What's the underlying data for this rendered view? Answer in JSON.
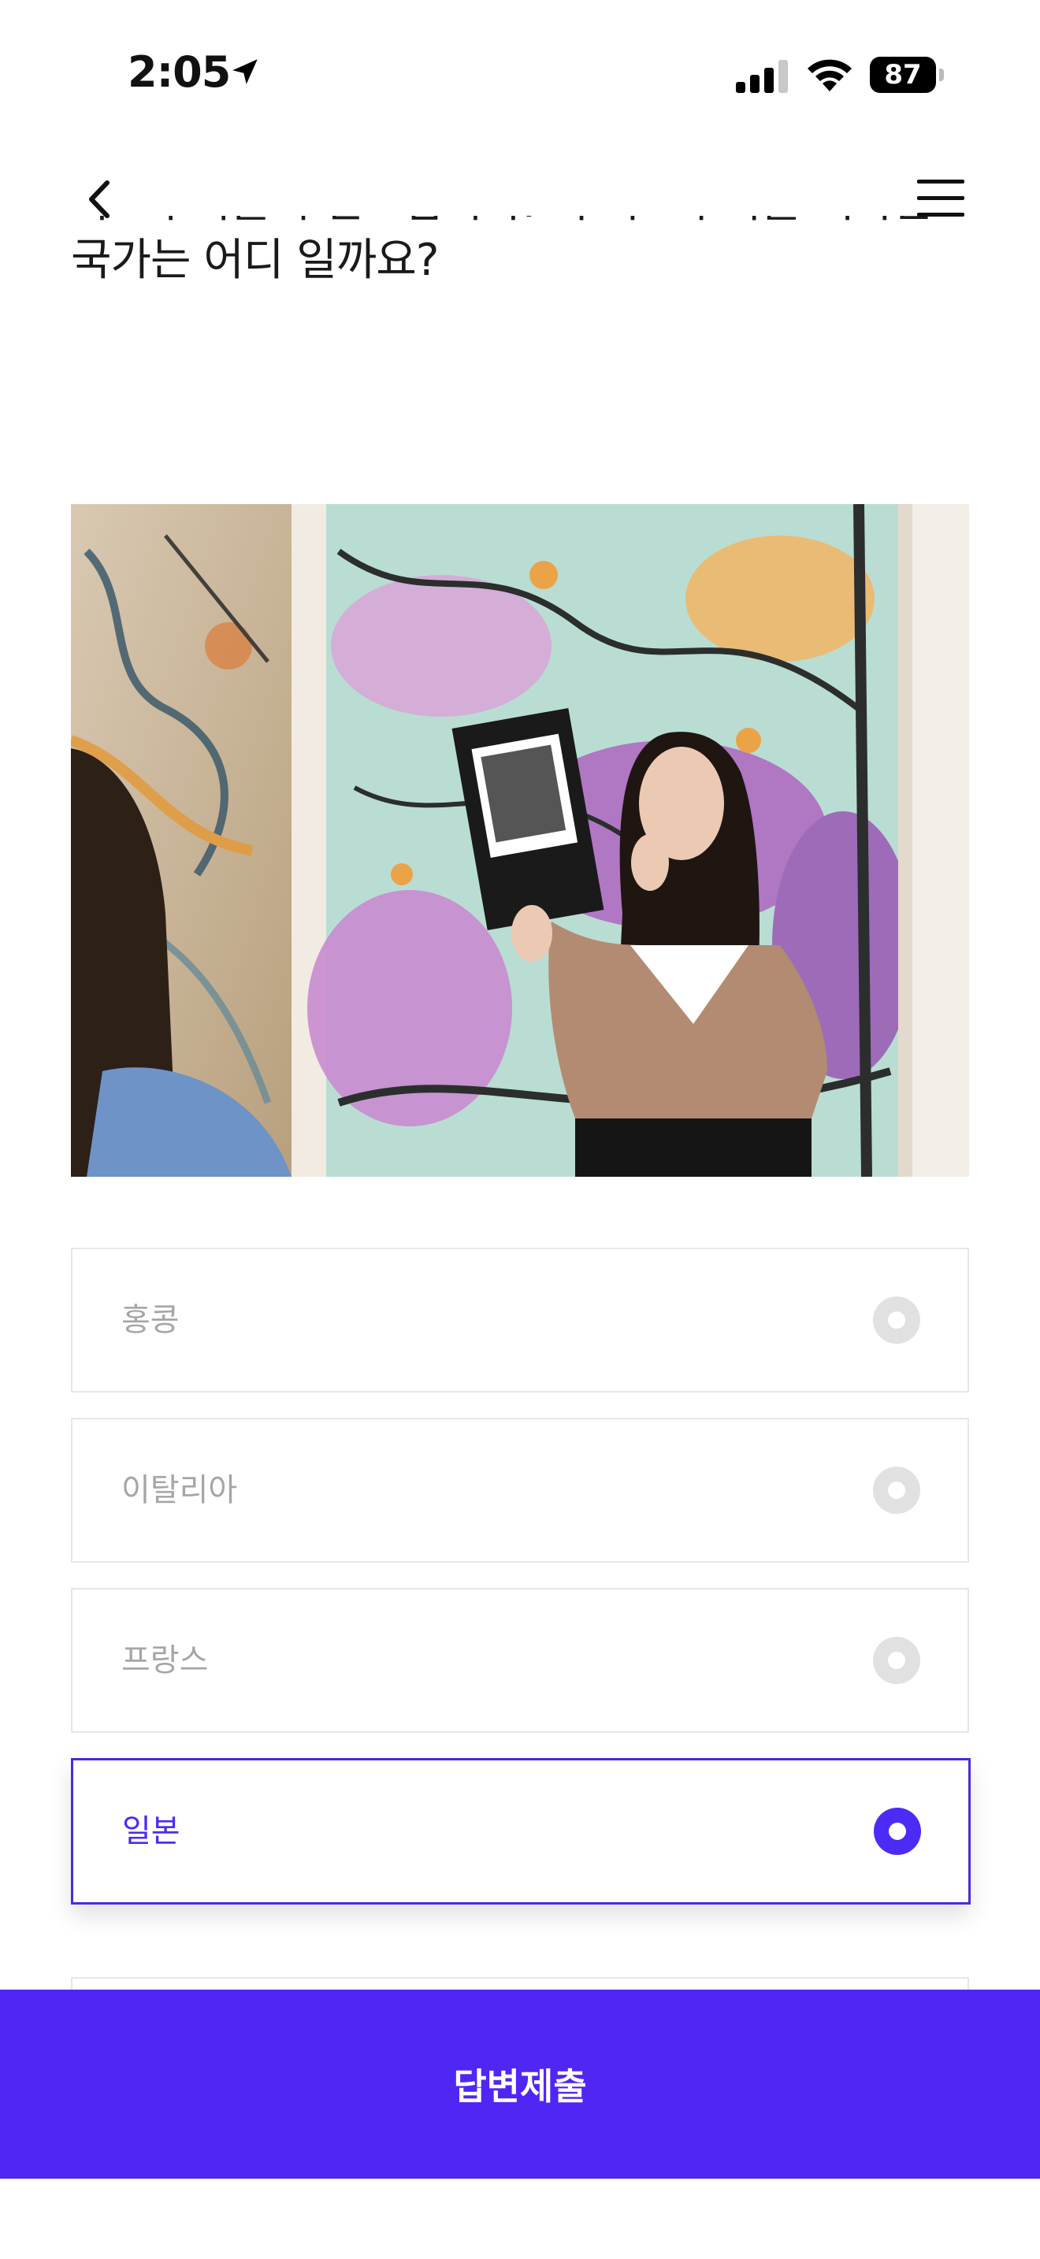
{
  "status_bar": {
    "time": "2:05",
    "battery": "87"
  },
  "question": {
    "text": "관심있는 분들을 위해 미술 전문가와 동행하는 아트투어를 추천드립니다. 이 아트투어를 떠나는 국가는 어디 일까요?"
  },
  "options": [
    {
      "label": "홍콩",
      "selected": false
    },
    {
      "label": "이탈리아",
      "selected": false
    },
    {
      "label": "프랑스",
      "selected": false
    },
    {
      "label": "일본",
      "selected": true
    }
  ],
  "submit": {
    "label": "답변제출"
  },
  "colors": {
    "accent": "#5026f5",
    "option_border": "#e7e7e7",
    "option_text": "#a6a6a6"
  },
  "icons": [
    "back-chevron-icon",
    "hamburger-menu-icon",
    "location-arrow-icon",
    "signal-icon",
    "wifi-icon",
    "battery-icon"
  ]
}
